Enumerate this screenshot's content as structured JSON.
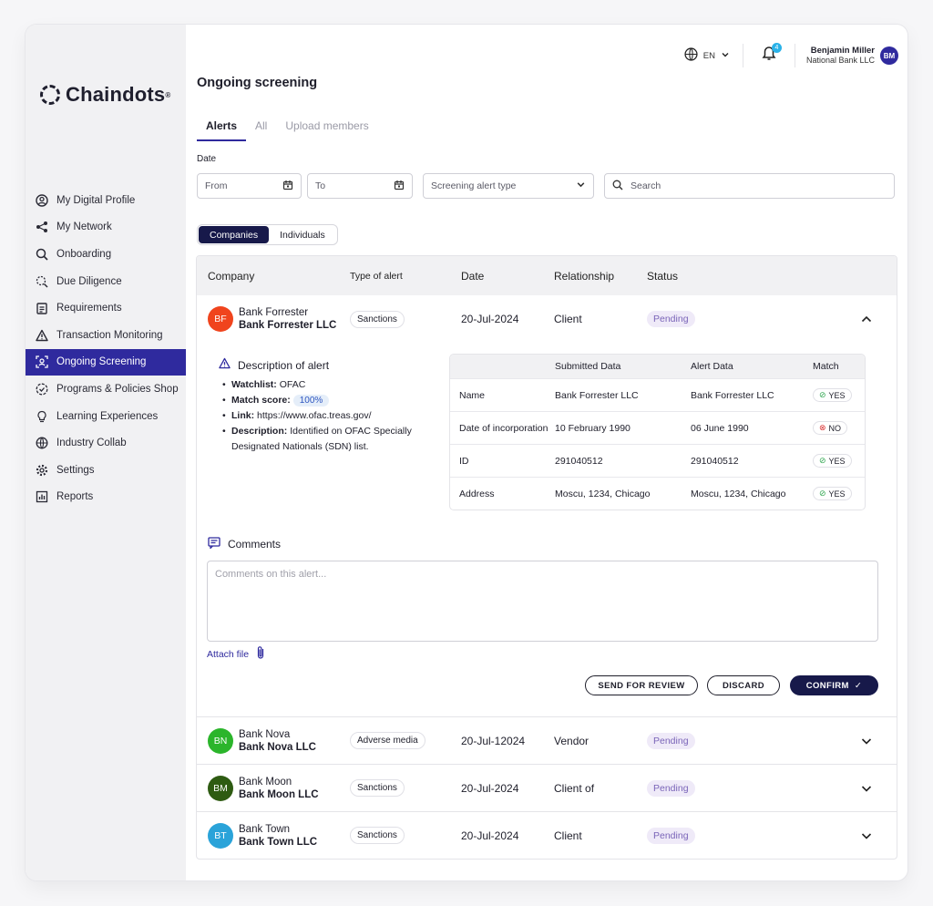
{
  "brand": {
    "name": "Chaindots",
    "mark": "®"
  },
  "sidebar": {
    "items": [
      {
        "label": "My Digital Profile"
      },
      {
        "label": "My Network"
      },
      {
        "label": "Onboarding"
      },
      {
        "label": "Due Diligence"
      },
      {
        "label": "Requirements"
      },
      {
        "label": "Transaction Monitoring"
      },
      {
        "label": "Ongoing Screening"
      },
      {
        "label": "Programs & Policies Shop"
      },
      {
        "label": "Learning Experiences"
      },
      {
        "label": "Industry Collab"
      },
      {
        "label": "Settings"
      },
      {
        "label": "Reports"
      }
    ]
  },
  "topbar": {
    "lang": "EN",
    "notif_count": "4",
    "user_name": "Benjamin Miller",
    "user_org": "National Bank LLC",
    "user_initials": "BM"
  },
  "page": {
    "title": "Ongoing screening"
  },
  "tabs": [
    {
      "label": "Alerts"
    },
    {
      "label": "All"
    },
    {
      "label": "Upload members"
    }
  ],
  "filters": {
    "date_label": "Date",
    "from": "From",
    "to": "To",
    "alert_type": "Screening alert type",
    "search": "Search"
  },
  "segment": {
    "companies": "Companies",
    "individuals": "Individuals"
  },
  "table": {
    "headers": {
      "company": "Company",
      "type": "Type of alert",
      "date": "Date",
      "relationship": "Relationship",
      "status": "Status"
    },
    "rows": [
      {
        "initials": "BF",
        "name": "Bank Forrester",
        "legal": "Bank Forrester LLC",
        "type": "Sanctions",
        "date": "20-Jul-2024",
        "relationship": "Client",
        "status": "Pending"
      },
      {
        "initials": "BN",
        "name": "Bank Nova",
        "legal": "Bank Nova LLC",
        "type": "Adverse media",
        "date": "20-Jul-12024",
        "relationship": "Vendor",
        "status": "Pending"
      },
      {
        "initials": "BM",
        "name": "Bank Moon",
        "legal": "Bank Moon LLC",
        "type": "Sanctions",
        "date": "20-Jul-2024",
        "relationship": "Client of",
        "status": "Pending"
      },
      {
        "initials": "BT",
        "name": "Bank Town",
        "legal": "Bank Town LLC",
        "type": "Sanctions",
        "date": "20-Jul-2024",
        "relationship": "Client",
        "status": "Pending"
      }
    ]
  },
  "detail": {
    "desc_title": "Description of alert",
    "watchlist_k": "Watchlist:",
    "watchlist_v": "OFAC",
    "score_k": "Match score:",
    "score_v": "100%",
    "link_k": "Link:",
    "link_v": "https://www.ofac.treas.gov/",
    "description_k": "Description:",
    "description_v": "Identified on OFAC Specially Designated Nationals (SDN) list.",
    "match_headers": {
      "submitted": "Submitted Data",
      "alert": "Alert Data",
      "match": "Match"
    },
    "match_rows": [
      {
        "field": "Name",
        "submitted": "Bank Forrester LLC",
        "alert": "Bank Forrester LLC",
        "match": "YES"
      },
      {
        "field": "Date of incorporation",
        "submitted": "10 February 1990",
        "alert": "06 June 1990",
        "match": "NO"
      },
      {
        "field": "ID",
        "submitted": "291040512",
        "alert": "291040512",
        "match": "YES"
      },
      {
        "field": "Address",
        "submitted": "Moscu, 1234, Chicago",
        "alert": "Moscu, 1234, Chicago",
        "match": "YES"
      }
    ],
    "comments_title": "Comments",
    "comments_placeholder": "Comments on this alert...",
    "attach": "Attach file",
    "send": "SEND FOR REVIEW",
    "discard": "DISCARD",
    "confirm": "CONFIRM"
  },
  "colors": {
    "accent": "#2f2a9e",
    "navy": "#17194a",
    "bf": "#f0441d",
    "bn": "#2bb52b",
    "bm": "#2e5b12",
    "bt": "#2aa3d9"
  }
}
